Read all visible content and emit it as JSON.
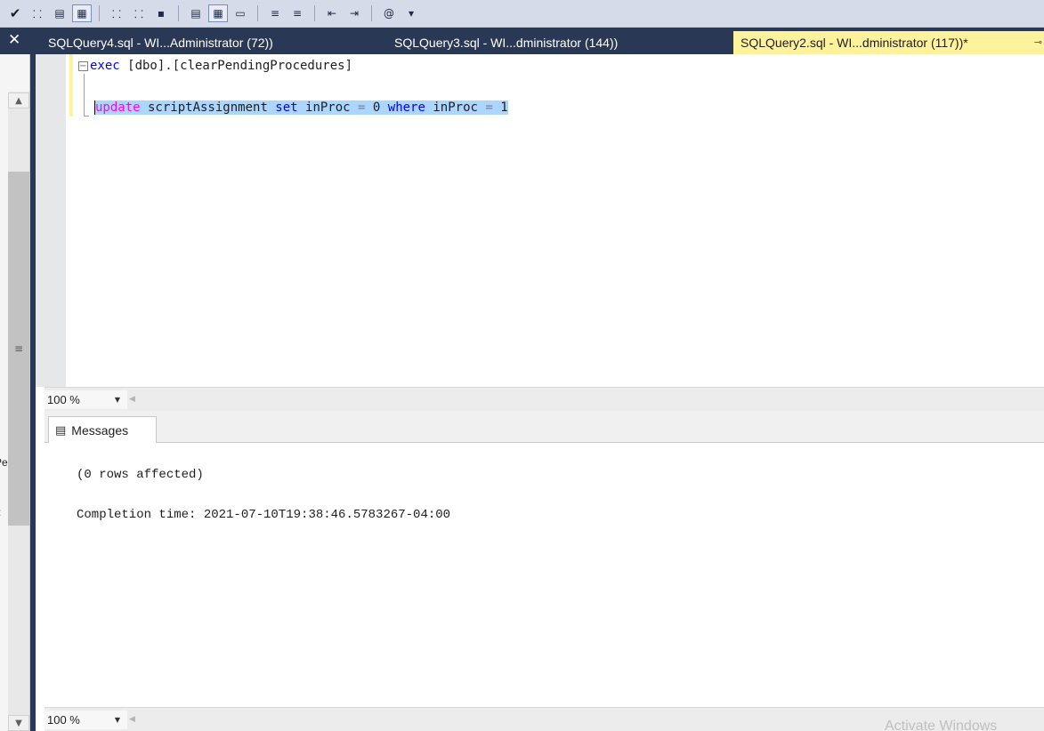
{
  "toolbar": {
    "buttons": [
      "parse-check",
      "debug",
      "display-plan",
      "results-to-grid",
      "include-plan",
      "include-stats",
      "query-options",
      "comment",
      "uncomment",
      "outdent",
      "indent",
      "specify-values"
    ]
  },
  "left_panel": {
    "close_glyph": "✕",
    "clipped_text_1": "Pe",
    "clipped_text_2": "r:"
  },
  "tabs": [
    {
      "label": "SQLQuery4.sql - WI...Administrator (72))",
      "active": false
    },
    {
      "label": "SQLQuery3.sql - WI...dministrator (144))",
      "active": false
    },
    {
      "label": "SQLQuery2.sql - WI...dministrator (117))*",
      "active": true
    }
  ],
  "editor": {
    "line1_exec": "exec",
    "line1_target": " [dbo].[clearPendingProcedures]",
    "line3": {
      "kw_update": "update",
      "ident_table": " scriptAssignment ",
      "kw_set": "set",
      "ident_col": " inProc ",
      "op_eq1": "=",
      "val_zero": " 0 ",
      "kw_where": "where",
      "ident_col2": " inProc ",
      "op_eq2": "=",
      "val_one": " 1"
    }
  },
  "zoom": {
    "top": "100 %",
    "bottom": "100 %"
  },
  "results": {
    "messages_tab": "Messages",
    "lines": [
      "(0 rows affected)",
      "Completion time: 2021-07-10T19:38:46.5783267-04:00"
    ]
  },
  "watermark": "Activate Windows",
  "colors": {
    "tab_strip": "#293955",
    "active_tab": "#fff29d",
    "selection": "#add6ff",
    "keyword_blue": "#0000ff",
    "keyword_pink": "#ff00ff"
  }
}
